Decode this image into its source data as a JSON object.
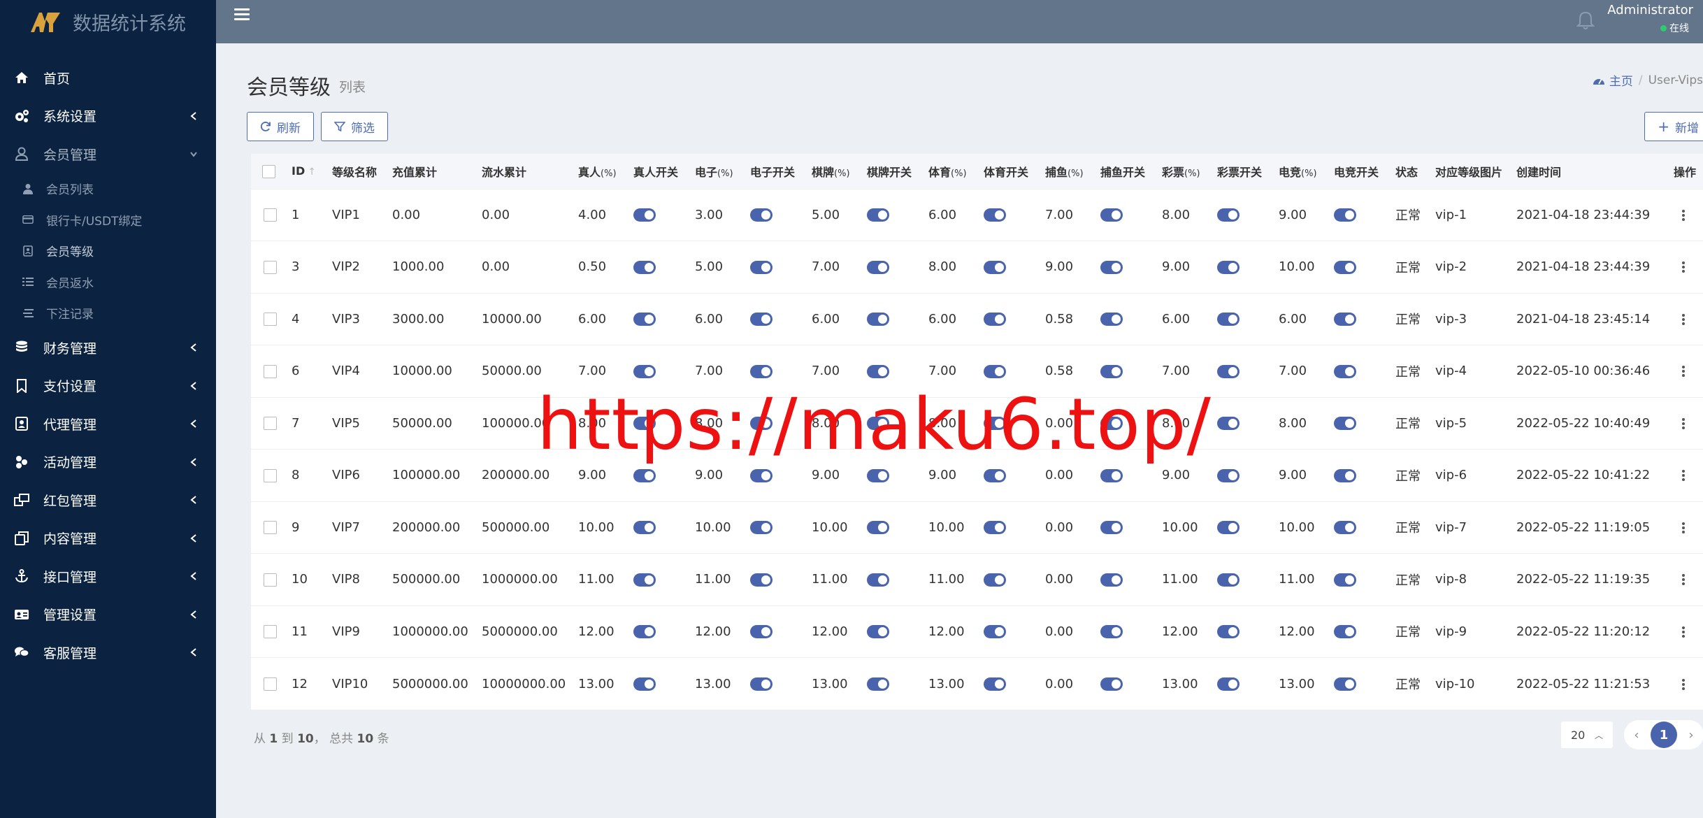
{
  "brand": {
    "title": "数据统计系统"
  },
  "sidebar": {
    "items": [
      {
        "label": "首页",
        "icon": "home-icon"
      },
      {
        "label": "系统设置",
        "icon": "gears-icon"
      },
      {
        "label": "会员管理",
        "icon": "user-icon",
        "open": true
      },
      {
        "label": "财务管理",
        "icon": "database-icon"
      },
      {
        "label": "支付设置",
        "icon": "bookmark-icon"
      },
      {
        "label": "代理管理",
        "icon": "user-badge-icon"
      },
      {
        "label": "活动管理",
        "icon": "puzzle-icon"
      },
      {
        "label": "红包管理",
        "icon": "gift-icon"
      },
      {
        "label": "内容管理",
        "icon": "copy-icon"
      },
      {
        "label": "接口管理",
        "icon": "anchor-icon"
      },
      {
        "label": "管理设置",
        "icon": "id-card-icon"
      },
      {
        "label": "客服管理",
        "icon": "chat-icon"
      }
    ],
    "subitems": [
      {
        "label": "会员列表",
        "icon": "user-icon"
      },
      {
        "label": "银行卡/USDT绑定",
        "icon": "card-icon"
      },
      {
        "label": "会员等级",
        "icon": "badge-icon",
        "active": true
      },
      {
        "label": "会员返水",
        "icon": "list-icon"
      },
      {
        "label": "下注记录",
        "icon": "stack-icon"
      }
    ]
  },
  "topbar": {
    "user_name": "Administrator",
    "user_status": "在线"
  },
  "page": {
    "title": "会员等级",
    "subtitle": "列表"
  },
  "breadcrumb": {
    "home": "主页",
    "separator": "/",
    "current": "User-Vips"
  },
  "toolbar": {
    "refresh_label": "刷新",
    "filter_label": "筛选",
    "add_label": "新增"
  },
  "table": {
    "headers": {
      "id": "ID",
      "name": "等级名称",
      "recharge": "充值累计",
      "flow": "流水累计",
      "live": "真人",
      "live_sw": "真人开关",
      "slot": "电子",
      "slot_sw": "电子开关",
      "chess": "棋牌",
      "chess_sw": "棋牌开关",
      "sport": "体育",
      "sport_sw": "体育开关",
      "fish": "捕鱼",
      "fish_sw": "捕鱼开关",
      "lottery": "彩票",
      "lottery_sw": "彩票开关",
      "esport": "电竞",
      "esport_sw": "电竞开关",
      "status": "状态",
      "image": "对应等级图片",
      "created": "创建时间",
      "action": "操作",
      "pct": "(%)"
    },
    "rows": [
      {
        "id": "1",
        "name": "VIP1",
        "recharge": "0.00",
        "flow": "0.00",
        "live": "4.00",
        "slot": "3.00",
        "chess": "5.00",
        "sport": "6.00",
        "fish": "7.00",
        "lottery": "8.00",
        "esport": "9.00",
        "status": "正常",
        "image": "vip-1",
        "created": "2021-04-18 23:44:39"
      },
      {
        "id": "3",
        "name": "VIP2",
        "recharge": "1000.00",
        "flow": "0.00",
        "live": "0.50",
        "slot": "5.00",
        "chess": "7.00",
        "sport": "8.00",
        "fish": "9.00",
        "lottery": "9.00",
        "esport": "10.00",
        "status": "正常",
        "image": "vip-2",
        "created": "2021-04-18 23:44:39"
      },
      {
        "id": "4",
        "name": "VIP3",
        "recharge": "3000.00",
        "flow": "10000.00",
        "live": "6.00",
        "slot": "6.00",
        "chess": "6.00",
        "sport": "6.00",
        "fish": "0.58",
        "lottery": "6.00",
        "esport": "6.00",
        "status": "正常",
        "image": "vip-3",
        "created": "2021-04-18 23:45:14"
      },
      {
        "id": "6",
        "name": "VIP4",
        "recharge": "10000.00",
        "flow": "50000.00",
        "live": "7.00",
        "slot": "7.00",
        "chess": "7.00",
        "sport": "7.00",
        "fish": "0.58",
        "lottery": "7.00",
        "esport": "7.00",
        "status": "正常",
        "image": "vip-4",
        "created": "2022-05-10 00:36:46"
      },
      {
        "id": "7",
        "name": "VIP5",
        "recharge": "50000.00",
        "flow": "100000.00",
        "live": "8.00",
        "slot": "8.00",
        "chess": "8.00",
        "sport": "8.00",
        "fish": "0.00",
        "lottery": "8.00",
        "esport": "8.00",
        "status": "正常",
        "image": "vip-5",
        "created": "2022-05-22 10:40:49"
      },
      {
        "id": "8",
        "name": "VIP6",
        "recharge": "100000.00",
        "flow": "200000.00",
        "live": "9.00",
        "slot": "9.00",
        "chess": "9.00",
        "sport": "9.00",
        "fish": "0.00",
        "lottery": "9.00",
        "esport": "9.00",
        "status": "正常",
        "image": "vip-6",
        "created": "2022-05-22 10:41:22"
      },
      {
        "id": "9",
        "name": "VIP7",
        "recharge": "200000.00",
        "flow": "500000.00",
        "live": "10.00",
        "slot": "10.00",
        "chess": "10.00",
        "sport": "10.00",
        "fish": "0.00",
        "lottery": "10.00",
        "esport": "10.00",
        "status": "正常",
        "image": "vip-7",
        "created": "2022-05-22 11:19:05"
      },
      {
        "id": "10",
        "name": "VIP8",
        "recharge": "500000.00",
        "flow": "1000000.00",
        "live": "11.00",
        "slot": "11.00",
        "chess": "11.00",
        "sport": "11.00",
        "fish": "0.00",
        "lottery": "11.00",
        "esport": "11.00",
        "status": "正常",
        "image": "vip-8",
        "created": "2022-05-22 11:19:35"
      },
      {
        "id": "11",
        "name": "VIP9",
        "recharge": "1000000.00",
        "flow": "5000000.00",
        "live": "12.00",
        "slot": "12.00",
        "chess": "12.00",
        "sport": "12.00",
        "fish": "0.00",
        "lottery": "12.00",
        "esport": "12.00",
        "status": "正常",
        "image": "vip-9",
        "created": "2022-05-22 11:20:12"
      },
      {
        "id": "12",
        "name": "VIP10",
        "recharge": "5000000.00",
        "flow": "10000000.00",
        "live": "13.00",
        "slot": "13.00",
        "chess": "13.00",
        "sport": "13.00",
        "fish": "0.00",
        "lottery": "13.00",
        "esport": "13.00",
        "status": "正常",
        "image": "vip-10",
        "created": "2022-05-22 11:21:53"
      }
    ]
  },
  "footer": {
    "from_label": "从",
    "from": "1",
    "to_label": "到",
    "to": "10",
    "total_label": "，  总共",
    "total": "10",
    "unit": "条"
  },
  "pagination": {
    "page_size": "20",
    "current_page": "1"
  },
  "watermark": {
    "text": "https://maku6.top/"
  },
  "colors": {
    "sidebar_bg": "#0b2240",
    "topbar_bg": "#63758b",
    "accent": "#4a63ad",
    "watermark": "#ee1111"
  }
}
